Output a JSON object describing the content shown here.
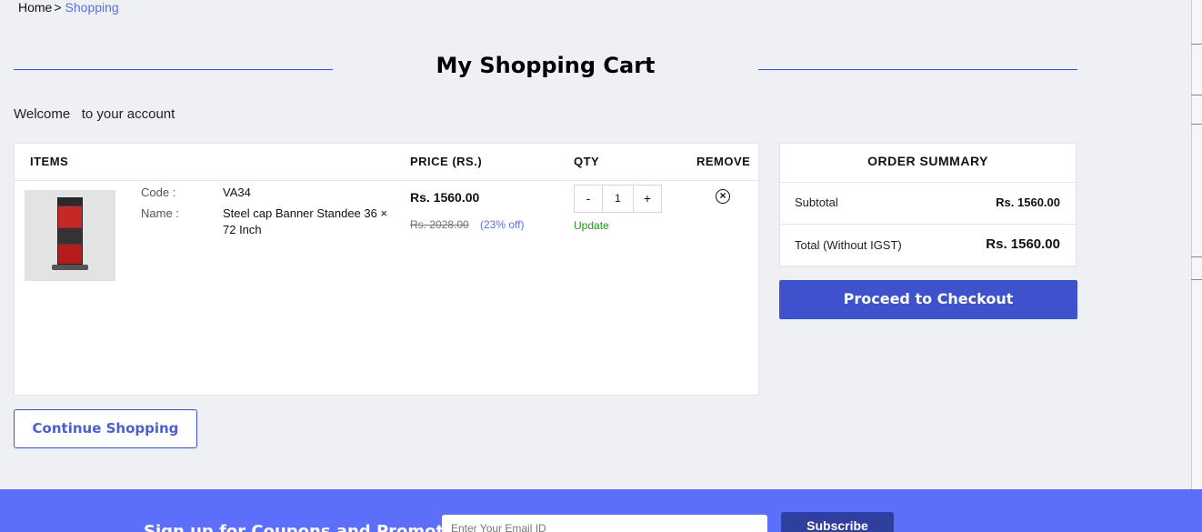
{
  "breadcrumb": {
    "home": "Home",
    "separator": ">",
    "current": "Shopping"
  },
  "page_title": "My Shopping Cart",
  "welcome": "Welcome   to your account",
  "cart": {
    "columns": {
      "items": "ITEMS",
      "price": "PRICE (RS.)",
      "qty": "QTY",
      "remove": "REMOVE"
    },
    "items": [
      {
        "code_label": "Code :",
        "code": "VA34",
        "name_label": "Name :",
        "name": "Steel cap Banner Standee 36 × 72 Inch",
        "price": "Rs. 1560.00",
        "original_price": "Rs. 2028.00",
        "discount": "(23% off)",
        "qty_minus": "-",
        "qty": "1",
        "qty_plus": "+",
        "update_label": "Update",
        "remove_icon": "close-circle-icon"
      }
    ]
  },
  "summary": {
    "title": "ORDER SUMMARY",
    "subtotal_label": "Subtotal",
    "subtotal_value": "Rs. 1560.00",
    "total_label": "Total (Without IGST)",
    "total_value": "Rs. 1560.00"
  },
  "buttons": {
    "checkout": "Proceed to Checkout",
    "continue": "Continue Shopping"
  },
  "footer": {
    "signup_text": "Sign up for Coupons and Promotions!",
    "email_placeholder": "Enter Your Email ID",
    "subscribe": "Subscribe"
  },
  "colors": {
    "accent": "#3d52cc",
    "footer_bg": "#5b6ffa",
    "link": "#5b6fe0",
    "update": "#1a9b1a"
  }
}
